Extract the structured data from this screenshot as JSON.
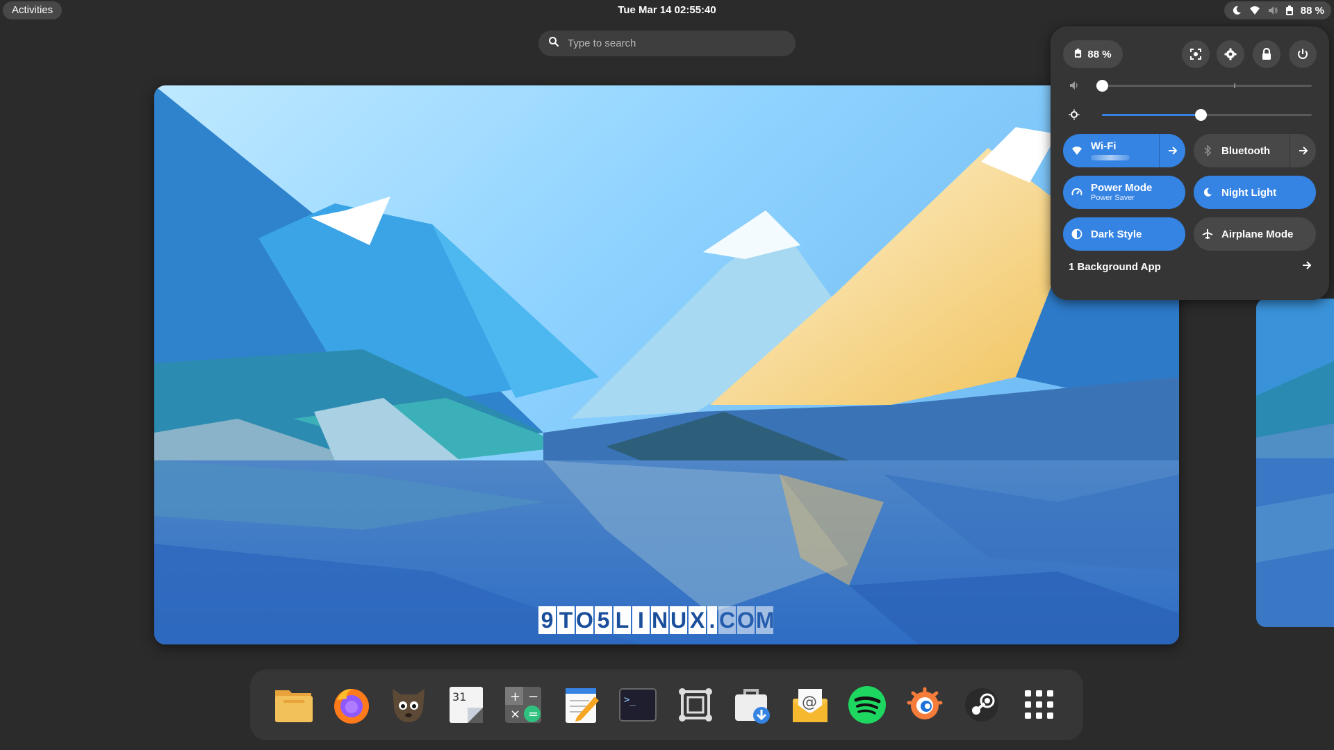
{
  "topbar": {
    "activities_label": "Activities",
    "clock": "Tue Mar 14  02:55:40",
    "battery_label": "88 %",
    "icons": [
      "night-light-icon",
      "wifi-icon",
      "volume-muted-icon",
      "battery-icon"
    ]
  },
  "search": {
    "placeholder": "Type to search"
  },
  "watermark": [
    "9",
    "T",
    "O",
    "5",
    "L",
    "I",
    "N",
    "U",
    "X",
    ".",
    "C",
    "O",
    "M"
  ],
  "dock": {
    "apps": [
      "Files",
      "Firefox",
      "GIMP",
      "Calendar",
      "Calculator",
      "Text Editor",
      "Terminal",
      "Screenshot",
      "Software",
      "Mail",
      "Spotify",
      "App",
      "Steam",
      "Show Applications"
    ]
  },
  "quick_settings": {
    "battery_label": "88 %",
    "volume": 0.0,
    "brightness": 0.47,
    "toggles": {
      "wifi": {
        "label": "Wi-Fi",
        "on": true
      },
      "bluetooth": {
        "label": "Bluetooth",
        "on": false
      },
      "power_mode": {
        "label": "Power Mode",
        "sub": "Power Saver",
        "on": true
      },
      "night_light": {
        "label": "Night Light",
        "on": true
      },
      "dark_style": {
        "label": "Dark Style",
        "on": true
      },
      "airplane_mode": {
        "label": "Airplane Mode",
        "on": false
      }
    },
    "background_apps_label": "1 Background App"
  },
  "colors": {
    "accent": "#3584e4",
    "panel_bg": "#353535",
    "button_bg": "#484848",
    "desktop_bg": "#2b2b2b"
  }
}
